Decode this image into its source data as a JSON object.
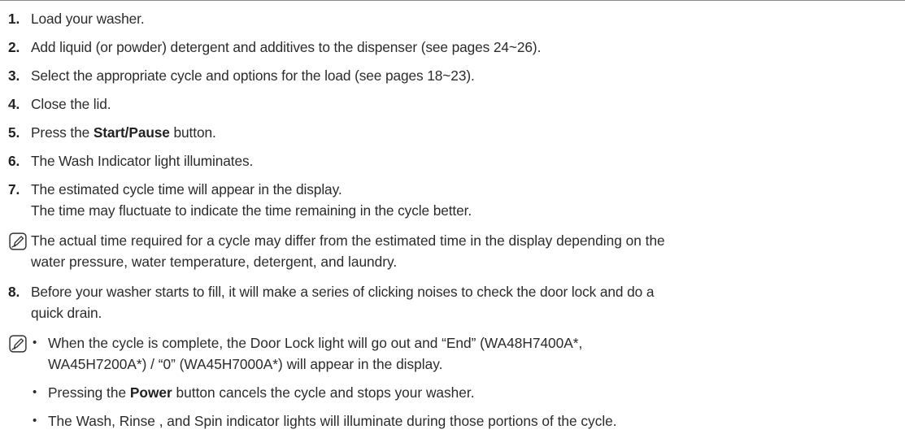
{
  "steps": [
    {
      "num": "1.",
      "text": "Load your washer."
    },
    {
      "num": "2.",
      "text": "Add liquid (or powder) detergent and additives to the dispenser (see pages 24~26)."
    },
    {
      "num": "3.",
      "text": "Select the appropriate cycle and options for the load (see pages 18~23)."
    },
    {
      "num": "4.",
      "text": "Close the lid."
    },
    {
      "num": "5.",
      "pre": "Press the ",
      "bold": "Start/Pause",
      "post": " button."
    },
    {
      "num": "6.",
      "text": "The Wash Indicator light illuminates."
    },
    {
      "num": "7.",
      "line1": "The estimated cycle time will appear in the display.",
      "line2": "The time may fluctuate to indicate the time remaining in the cycle better."
    },
    {
      "num": "8.",
      "line1": "Before your washer starts to fill, it will make a series of clicking noises to check the door lock and do a",
      "line2": "quick drain."
    }
  ],
  "note1": {
    "icon": "note-pencil-icon",
    "line1": "The actual time required for a cycle may differ from the estimated time in the display depending on the",
    "line2": "water pressure, water temperature, detergent, and laundry."
  },
  "note2": {
    "icon": "note-pencil-icon",
    "bullet_glyph": "•",
    "bullets": [
      {
        "line1": "When the cycle is complete, the Door Lock light will go out and “End” (WA48H7400A*,",
        "line2": "WA45H7200A*) / “0” (WA45H7000A*) will appear in the display."
      },
      {
        "pre": "Pressing the ",
        "bold": "Power",
        "post": " button cancels the cycle and stops your washer."
      },
      {
        "text": "The Wash, Rinse , and Spin indicator lights will illuminate during those portions of the cycle."
      }
    ]
  }
}
